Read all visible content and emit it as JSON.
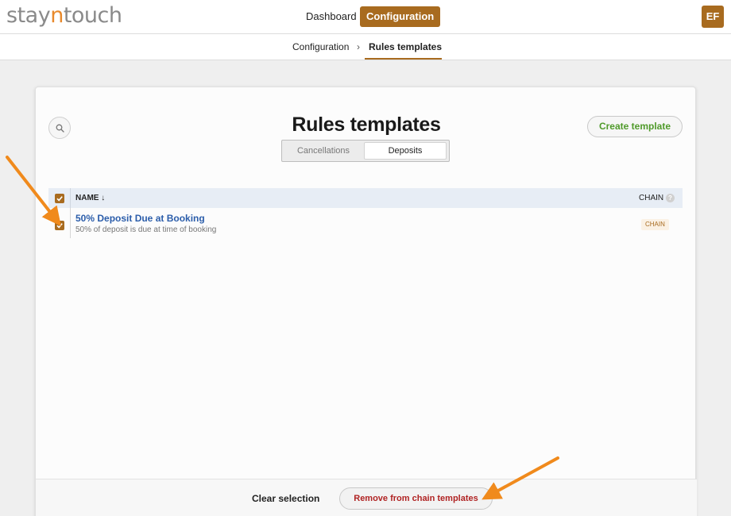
{
  "header": {
    "logo": {
      "prefix": "stay",
      "accent": "n",
      "suffix": "touch"
    },
    "nav": [
      {
        "label": "Dashboard",
        "active": false
      },
      {
        "label": "Configuration",
        "active": true
      }
    ],
    "user_initials": "EF"
  },
  "breadcrumb": {
    "parent": "Configuration",
    "separator": "›",
    "current": "Rules templates"
  },
  "page": {
    "title": "Rules templates",
    "create_button": "Create template",
    "tabs": [
      {
        "label": "Cancellations",
        "active": false
      },
      {
        "label": "Deposits",
        "active": true
      }
    ]
  },
  "table": {
    "columns": {
      "name": "NAME ↓",
      "chain": "CHAIN",
      "help": "?"
    },
    "header_checkbox_checked": true,
    "rows": [
      {
        "name": "50% Deposit Due at Booking",
        "description": "50% of deposit is due at time of booking",
        "badge": "CHAIN",
        "checked": true
      }
    ]
  },
  "footer": {
    "clear_label": "Clear selection",
    "remove_label": "Remove from chain templates"
  },
  "colors": {
    "brand": "#a86b1f",
    "logo_accent": "#e8892b",
    "create_text": "#4f9a2a",
    "remove_text": "#b02323",
    "link": "#2b5daa",
    "annotation_arrow": "#f08a1c"
  },
  "icons": [
    "search-icon",
    "checkbox-check-icon",
    "help-icon",
    "annotation-arrow"
  ]
}
